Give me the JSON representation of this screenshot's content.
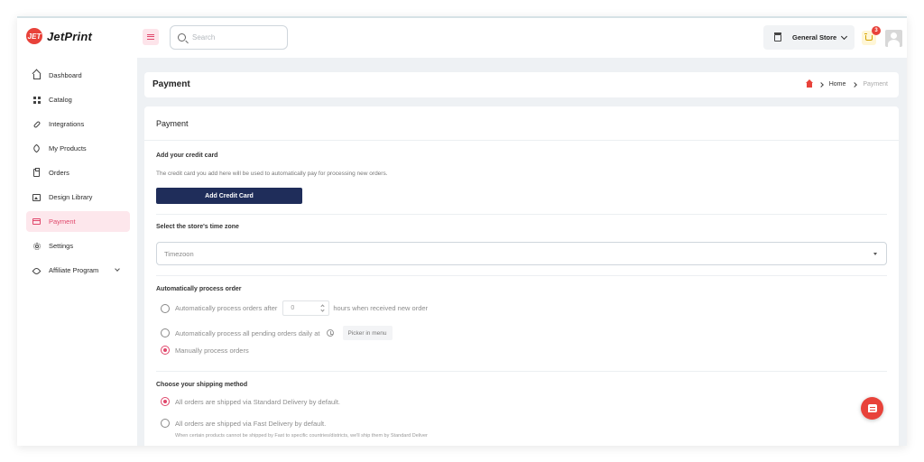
{
  "brand": {
    "logo_mark": "JET",
    "name": "JetPrint"
  },
  "header": {
    "search_placeholder": "Search",
    "store_name": "General Store",
    "cart_count": "3"
  },
  "sidebar": {
    "items": [
      {
        "label": "Dashboard",
        "icon": "home-icon"
      },
      {
        "label": "Catalog",
        "icon": "grid-icon"
      },
      {
        "label": "Integrations",
        "icon": "link-icon"
      },
      {
        "label": "My Products",
        "icon": "tag-icon"
      },
      {
        "label": "Orders",
        "icon": "clipboard-icon"
      },
      {
        "label": "Design Library",
        "icon": "image-icon"
      },
      {
        "label": "Payment",
        "icon": "credit-card-icon",
        "active": true
      },
      {
        "label": "Settings",
        "icon": "gear-icon"
      },
      {
        "label": "Affiliate Program",
        "icon": "heart-icon"
      }
    ]
  },
  "page": {
    "title": "Payment",
    "breadcrumb": {
      "home": "Home",
      "current": "Payment"
    }
  },
  "card": {
    "title": "Payment",
    "credit": {
      "title": "Add your credit card",
      "description": "The credit card you add here will be used to automatically pay for processing new orders.",
      "button": "Add Credit Card"
    },
    "timezone": {
      "title": "Select the store's time zone",
      "value": "Timezoon"
    },
    "auto": {
      "title": "Automatically process order",
      "opt1_before": "Automatically process orders after",
      "opt1_value": "0",
      "opt1_after": "hours when received new order",
      "opt2": "Automatically process all pending orders daily at",
      "opt2_picker": "Picker in menu",
      "opt3": "Manually process orders"
    },
    "shipping": {
      "title": "Choose your shipping method",
      "opt1": "All orders are shipped via Standard Delivery by default.",
      "opt2": "All orders are shipped via Fast Delivery by default.",
      "opt2_note": "When certain products cannot be shipped by Fast to specific countries/districts, we'll ship them by Standard Deliver"
    }
  },
  "colors": {
    "accent": "#e0476b",
    "primary_button": "#1f2d5a",
    "brand_red": "#e8423a"
  }
}
